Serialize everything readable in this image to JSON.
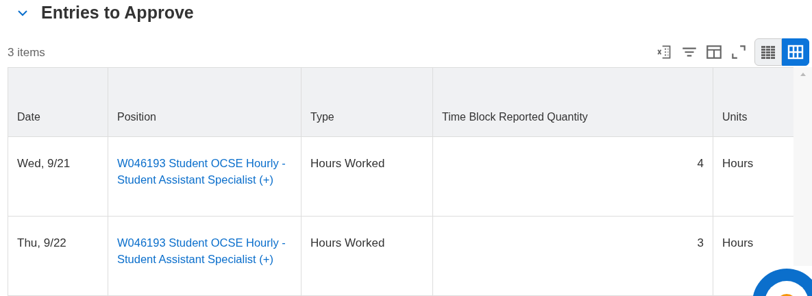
{
  "section": {
    "title": "Entries to Approve",
    "expanded": true
  },
  "count": "3 items",
  "view_toggle": [
    {
      "kind": "table",
      "selected": false
    },
    {
      "kind": "grid",
      "selected": true
    }
  ],
  "table": {
    "columns": [
      "Date",
      "Position",
      "Type",
      "Time Block Reported Quantity",
      "Units"
    ],
    "rows": [
      {
        "date": "Wed, 9/21",
        "position": "W046193 Student OCSE Hourly - Student Assistant Specialist (+)",
        "type": "Hours Worked",
        "quantity": "4",
        "units": "Hours"
      },
      {
        "date": "Thu, 9/22",
        "position": "W046193 Student OCSE Hourly - Student Assistant Specialist (+)",
        "type": "Hours Worked",
        "quantity": "3",
        "units": "Hours"
      }
    ]
  }
}
